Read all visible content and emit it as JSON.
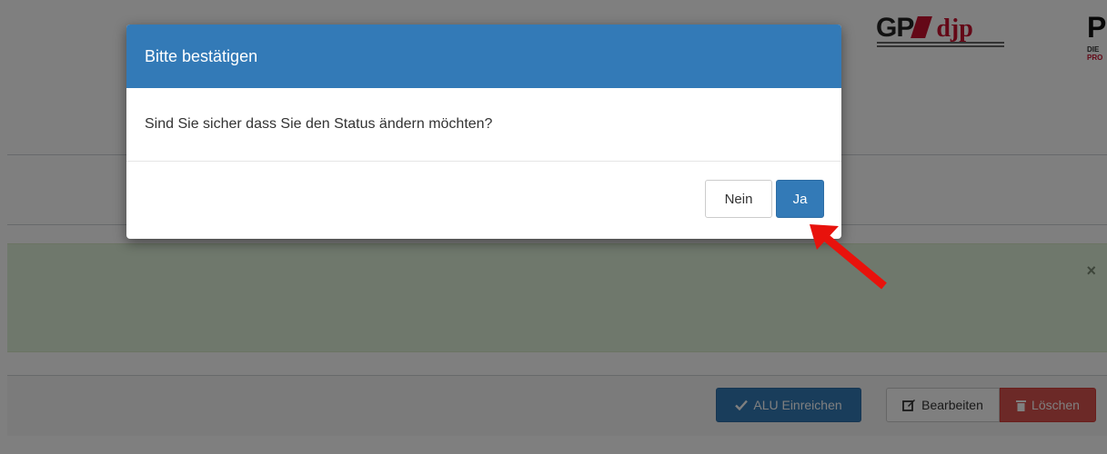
{
  "logos": {
    "gpa": "GP",
    "djp": "djp",
    "pr": "PF",
    "pr_sub_prefix": "DIE",
    "pr_sub_highlight": "PRO"
  },
  "alert": {
    "close_glyph": "×"
  },
  "actions": {
    "alu_label": "ALU Einreichen",
    "edit_label": "Bearbeiten",
    "delete_label": "Löschen"
  },
  "modal": {
    "title": "Bitte bestätigen",
    "message": "Sind Sie sicher dass Sie den Status ändern möchten?",
    "no_label": "Nein",
    "yes_label": "Ja"
  },
  "colors": {
    "primary": "#337ab7",
    "danger": "#d9534f",
    "success_bg": "#dff0d8",
    "annotation_arrow": "#e8120c"
  },
  "icons": {
    "alu": "check-icon",
    "edit": "edit-icon",
    "delete": "trash-icon",
    "close": "close-icon",
    "annotation": "red-arrow-icon"
  }
}
